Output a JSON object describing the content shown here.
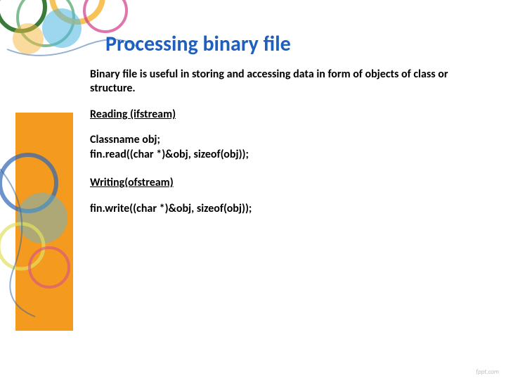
{
  "title": "Processing binary file",
  "intro": "Binary file is useful in storing and accessing data in form of objects of class or structure.",
  "section1": {
    "heading": "Reading (ifstream)",
    "line1": "Classname obj;",
    "line2": "fin.read((char *)&obj, sizeof(obj));"
  },
  "section2": {
    "heading": "Writing(ofstream)",
    "line1": "fin.write((char *)&obj, sizeof(obj));"
  },
  "footer": "fppt.com"
}
